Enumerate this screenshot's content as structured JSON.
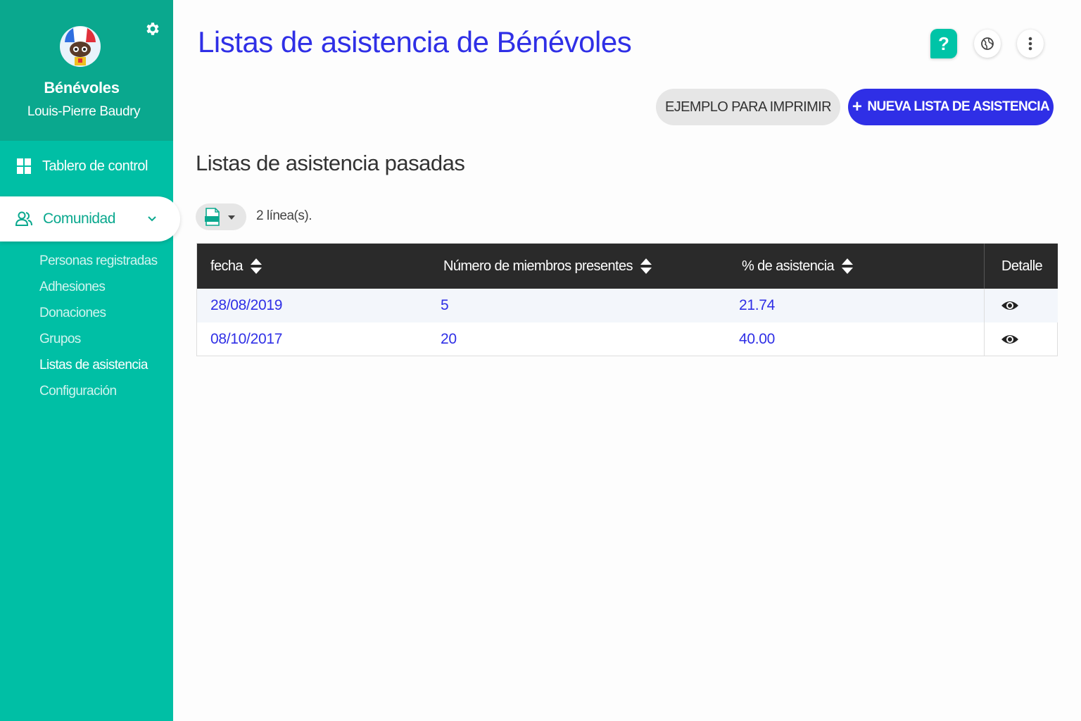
{
  "sidebar": {
    "org_name": "Bénévoles",
    "user_name": "Louis-Pierre Baudry",
    "dashboard_label": "Tablero de control",
    "community_label": "Comunidad",
    "subitems": [
      {
        "label": "Personas registradas"
      },
      {
        "label": "Adhesiones"
      },
      {
        "label": "Donaciones"
      },
      {
        "label": "Grupos"
      },
      {
        "label": "Listas de asistencia"
      },
      {
        "label": "Configuración"
      }
    ]
  },
  "header": {
    "title": "Listas de asistencia de Bénévoles",
    "help_label": "?"
  },
  "actions": {
    "example_label": "EJEMPLO PARA IMPRIMIR",
    "new_plus": "+",
    "new_label": "NUEVA LISTA DE ASISTENCIA"
  },
  "section": {
    "title": "Listas de asistencia pasadas",
    "row_count": "2 línea(s)."
  },
  "table": {
    "columns": {
      "date": "fecha",
      "members": "Número de miembros presentes",
      "attendance": "% de asistencia",
      "detail": "Detalle"
    },
    "rows": [
      {
        "date": "28/08/2019",
        "members": "5",
        "attendance": "21.74"
      },
      {
        "date": "08/10/2017",
        "members": "20",
        "attendance": "40.00"
      }
    ]
  },
  "colors": {
    "sidebar": "#00bfa5",
    "sidebar_header": "#0aa88e",
    "accent": "#2f2fe6",
    "table_header": "#2a2a2a"
  },
  "icons": {
    "settings": "gear-icon",
    "dashboard": "grid-icon",
    "community": "users-icon",
    "language": "globe-icon",
    "more": "more-vertical-icon",
    "export": "xlsx-file-icon",
    "detail": "eye-icon",
    "sort": "sort-icon"
  }
}
